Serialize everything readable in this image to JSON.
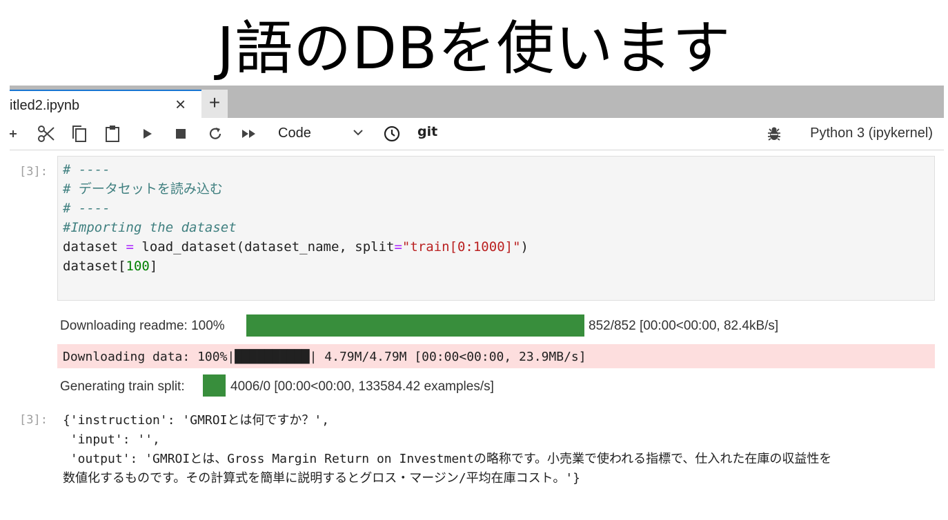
{
  "slide_title": "J語のDBを使います",
  "tab": {
    "name": "itled2.ipynb",
    "close_glyph": "×",
    "add_glyph": "+"
  },
  "toolbar": {
    "cell_type": "Code",
    "git_label": "git",
    "kernel": "Python 3 (ipykernel)",
    "icons": [
      "add-icon",
      "cut-icon",
      "copy-icon",
      "paste-icon",
      "run-icon",
      "stop-icon",
      "restart-icon",
      "run-all-icon",
      "chevron-down-icon",
      "clock-icon",
      "bug-icon"
    ]
  },
  "cell": {
    "input_prompt": "[3]:",
    "code_lines": [
      {
        "parts": [
          {
            "t": "# ----",
            "c": "cm"
          }
        ]
      },
      {
        "parts": [
          {
            "t": "# データセットを読み込む",
            "c": "cm-up"
          }
        ]
      },
      {
        "parts": [
          {
            "t": "# ----",
            "c": "cm"
          }
        ]
      },
      {
        "parts": [
          {
            "t": "#Importing the dataset",
            "c": "cm"
          }
        ]
      },
      {
        "parts": [
          {
            "t": "dataset ",
            "c": "k"
          },
          {
            "t": "=",
            "c": "op"
          },
          {
            "t": " load_dataset(dataset_name, split",
            "c": "k"
          },
          {
            "t": "=",
            "c": "op"
          },
          {
            "t": "\"train[0:1000]\"",
            "c": "st"
          },
          {
            "t": ")",
            "c": "k"
          }
        ]
      },
      {
        "parts": [
          {
            "t": "dataset[",
            "c": "k"
          },
          {
            "t": "100",
            "c": "nm"
          },
          {
            "t": "]",
            "c": "k"
          }
        ]
      }
    ],
    "outputs": {
      "readme": {
        "label": "Downloading readme: 100%",
        "progress": 1.0,
        "stats": "852/852 [00:00<00:00, 82.4kB/s]"
      },
      "data": {
        "text": "Downloading data: 100%|██████████| 4.79M/4.79M [00:00<00:00, 23.9MB/s]"
      },
      "split": {
        "label": "Generating train split:",
        "progress": 1.0,
        "stats": "4006/0 [00:00<00:00, 133584.42 examples/s]"
      }
    },
    "output_prompt": "[3]:",
    "result_lines": [
      "{'instruction': 'GMROIとは何ですか？',",
      " 'input': '',",
      " 'output': 'GMROIとは、Gross Margin Return on Investmentの略称です。小売業で使われる指標で、仕入れた在庫の収益性を",
      "数値化するものです。その計算式を簡単に説明するとグロス・マージン/平均在庫コスト。'}"
    ]
  },
  "colors": {
    "accent": "#1976d2",
    "progress": "#388e3c",
    "stderr_bg": "#fddede"
  }
}
